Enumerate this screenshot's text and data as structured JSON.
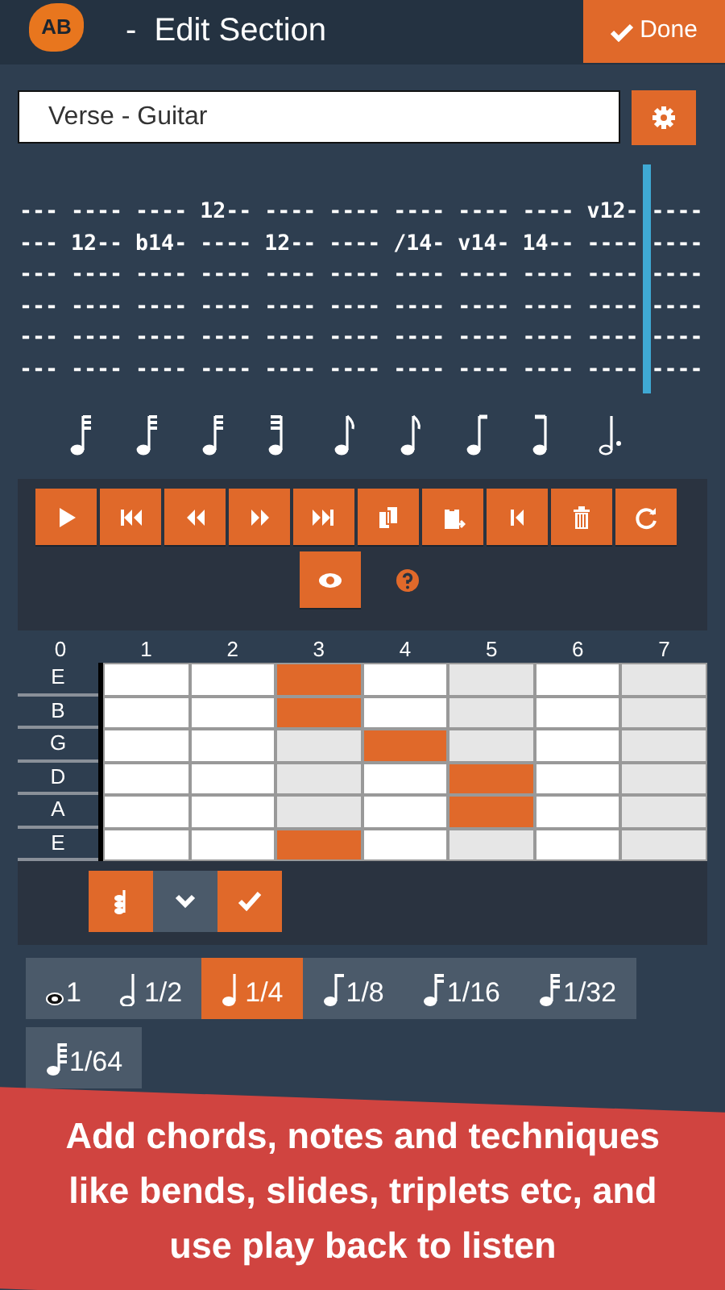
{
  "header": {
    "logo": "AB",
    "title": "-  Edit Section",
    "done_button": "Done"
  },
  "section_name": {
    "value": "Verse - Guitar"
  },
  "tab_lines": [
    "--- ---- ---- 12-- ---- ---- ---- ---- ---- v12- ----",
    "--- 12-- b14- ---- 12-- ---- /14- v14- 14-- ---- ----",
    "--- ---- ---- ---- ---- ---- ---- ---- ---- ---- ----",
    "--- ---- ---- ---- ---- ---- ---- ---- ---- ---- ----",
    "--- ---- ---- ---- ---- ---- ---- ---- ---- ---- ----",
    "--- ---- ---- ---- ---- ---- ---- ---- ---- ---- ----"
  ],
  "rhythm": [
    {
      "kind": "flag32"
    },
    {
      "kind": "flag32"
    },
    {
      "kind": "flag32"
    },
    {
      "kind": "beam32-end"
    },
    {
      "kind": "flag8"
    },
    {
      "kind": "flag8"
    },
    {
      "kind": "beam8-start"
    },
    {
      "kind": "beam8-end"
    },
    {
      "kind": "dotted-half"
    }
  ],
  "toolbar": [
    {
      "kind": "play"
    },
    {
      "kind": "skip-start"
    },
    {
      "kind": "rewind"
    },
    {
      "kind": "forward"
    },
    {
      "kind": "skip-end"
    },
    {
      "kind": "copy"
    },
    {
      "kind": "paste"
    },
    {
      "kind": "step-back"
    },
    {
      "kind": "trash"
    },
    {
      "kind": "refresh"
    },
    {
      "kind": "eye"
    },
    {
      "kind": "help"
    }
  ],
  "fretboard": {
    "frets": [
      "0",
      "1",
      "2",
      "3",
      "4",
      "5",
      "6",
      "7"
    ],
    "strings": [
      {
        "name": "E",
        "cells": [
          {
            "selected": false,
            "shaded": false
          },
          {
            "selected": false,
            "shaded": false
          },
          {
            "selected": true,
            "shaded": false
          },
          {
            "selected": false,
            "shaded": false
          },
          {
            "selected": false,
            "shaded": true
          },
          {
            "selected": false,
            "shaded": false
          },
          {
            "selected": false,
            "shaded": true
          }
        ]
      },
      {
        "name": "B",
        "cells": [
          {
            "selected": false,
            "shaded": false
          },
          {
            "selected": false,
            "shaded": false
          },
          {
            "selected": true,
            "shaded": false
          },
          {
            "selected": false,
            "shaded": false
          },
          {
            "selected": false,
            "shaded": true
          },
          {
            "selected": false,
            "shaded": false
          },
          {
            "selected": false,
            "shaded": true
          }
        ]
      },
      {
        "name": "G",
        "cells": [
          {
            "selected": false,
            "shaded": false
          },
          {
            "selected": false,
            "shaded": false
          },
          {
            "selected": false,
            "shaded": true
          },
          {
            "selected": true,
            "shaded": false
          },
          {
            "selected": false,
            "shaded": true
          },
          {
            "selected": false,
            "shaded": false
          },
          {
            "selected": false,
            "shaded": true
          }
        ]
      },
      {
        "name": "D",
        "cells": [
          {
            "selected": false,
            "shaded": false
          },
          {
            "selected": false,
            "shaded": false
          },
          {
            "selected": false,
            "shaded": true
          },
          {
            "selected": false,
            "shaded": false
          },
          {
            "selected": true,
            "shaded": false
          },
          {
            "selected": false,
            "shaded": false
          },
          {
            "selected": false,
            "shaded": true
          }
        ]
      },
      {
        "name": "A",
        "cells": [
          {
            "selected": false,
            "shaded": false
          },
          {
            "selected": false,
            "shaded": false
          },
          {
            "selected": false,
            "shaded": true
          },
          {
            "selected": false,
            "shaded": false
          },
          {
            "selected": true,
            "shaded": false
          },
          {
            "selected": false,
            "shaded": false
          },
          {
            "selected": false,
            "shaded": true
          }
        ]
      },
      {
        "name": "E",
        "cells": [
          {
            "selected": false,
            "shaded": false
          },
          {
            "selected": false,
            "shaded": false
          },
          {
            "selected": true,
            "shaded": false
          },
          {
            "selected": false,
            "shaded": false
          },
          {
            "selected": false,
            "shaded": true
          },
          {
            "selected": false,
            "shaded": false
          },
          {
            "selected": false,
            "shaded": true
          }
        ]
      }
    ]
  },
  "chord_actions": [
    {
      "kind": "chord",
      "selected": true
    },
    {
      "kind": "expand",
      "selected": false
    },
    {
      "kind": "confirm",
      "selected": true
    }
  ],
  "durations": [
    {
      "label": "1",
      "kind": "whole",
      "selected": false
    },
    {
      "label": "1/2",
      "kind": "half",
      "selected": false
    },
    {
      "label": "1/4",
      "kind": "quarter",
      "selected": true
    },
    {
      "label": "1/8",
      "kind": "eighth",
      "selected": false
    },
    {
      "label": "1/16",
      "kind": "sixteenth",
      "selected": false
    },
    {
      "label": "1/32",
      "kind": "thirty-second",
      "selected": false
    },
    {
      "label": "1/64",
      "kind": "sixty-fourth",
      "selected": false
    }
  ],
  "banner": {
    "text": "Add chords, notes and techniques like bends, slides, triplets etc, and use play back to listen"
  }
}
